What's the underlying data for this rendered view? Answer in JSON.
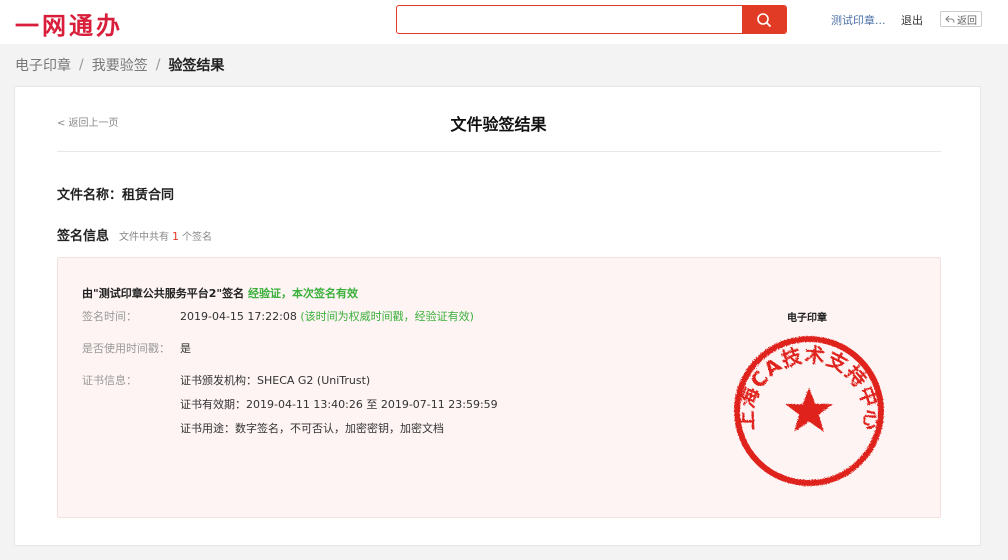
{
  "header": {
    "logo": "一网通办",
    "search_placeholder": "",
    "user": "测试印章...",
    "logout": "退出",
    "back": "返回"
  },
  "breadcrumb": [
    "电子印章",
    "我要验签",
    "验签结果"
  ],
  "page": {
    "back_link": "< 返回上一页",
    "title": "文件验签结果",
    "file_name": "文件名称：租赁合同",
    "sig_info_label": "签名信息",
    "sig_info_prefix": "文件中共有",
    "sig_info_count": "1",
    "sig_info_suffix": "个签名"
  },
  "signature": {
    "signer": "由\"测试印章公共服务平台2\"签名",
    "status": "经验证，本次签名有效",
    "time_label": "签名时间：",
    "time_value": "2019-04-15 17:22:08",
    "time_note": "(该时间为权威时间戳，经验证有效)",
    "timestamp_label": "是否使用时间戳：",
    "timestamp_value": "是",
    "cert_label": "证书信息：",
    "cert_issuer": "证书颁发机构：SHECA G2 (UniTrust)",
    "cert_validity": "证书有效期：2019-04-11 13:40:26 至 2019-07-11 23:59:59",
    "cert_usage": "证书用途：数字签名，不可否认，加密密钥，加密文档"
  },
  "seal": {
    "caption": "电子印章",
    "ring_text": "上海CA技术支持中心",
    "color": "#e0211c"
  },
  "colors": {
    "brand": "#d81e3a",
    "search_button": "#e23b25",
    "valid_green": "#3bb03b"
  }
}
